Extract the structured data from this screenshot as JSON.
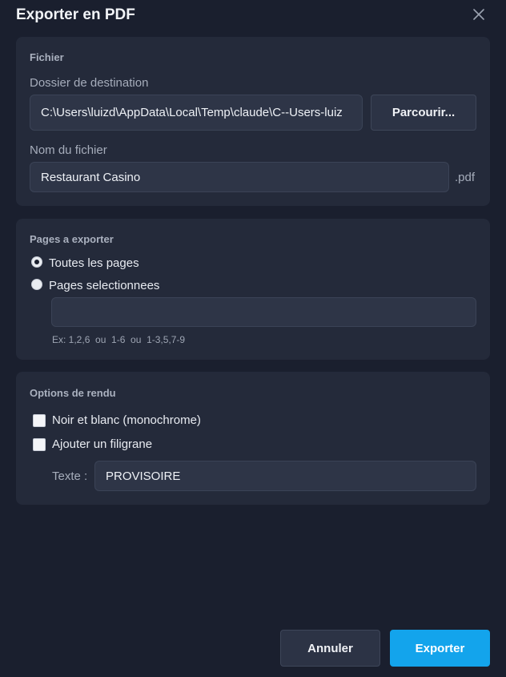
{
  "dialog": {
    "title": "Exporter en PDF"
  },
  "file_section": {
    "heading": "Fichier",
    "folder_label": "Dossier de destination",
    "folder_value": "C:\\Users\\luizd\\AppData\\Local\\Temp\\claude\\C--Users-luiz",
    "browse_label": "Parcourir...",
    "filename_label": "Nom du fichier",
    "filename_value": "Restaurant Casino",
    "extension": ".pdf"
  },
  "pages_section": {
    "heading": "Pages a exporter",
    "options": [
      {
        "label": "Toutes les pages",
        "selected": true
      },
      {
        "label": "Pages selectionnees",
        "selected": false
      }
    ],
    "range_value": "",
    "hint": "Ex: 1,2,6  ou  1-6  ou  1-3,5,7-9"
  },
  "render_section": {
    "heading": "Options de rendu",
    "options": [
      {
        "label": "Noir et blanc (monochrome)",
        "checked": false
      },
      {
        "label": "Ajouter un filigrane",
        "checked": false
      }
    ],
    "watermark_label": "Texte :",
    "watermark_value": "PROVISOIRE"
  },
  "footer": {
    "cancel_label": "Annuler",
    "export_label": "Exporter"
  },
  "colors": {
    "background": "#1a1f2e",
    "panel": "#242a3a",
    "input": "#2e3547",
    "accent": "#13a4ec"
  },
  "icons": {
    "close": "close-icon"
  }
}
